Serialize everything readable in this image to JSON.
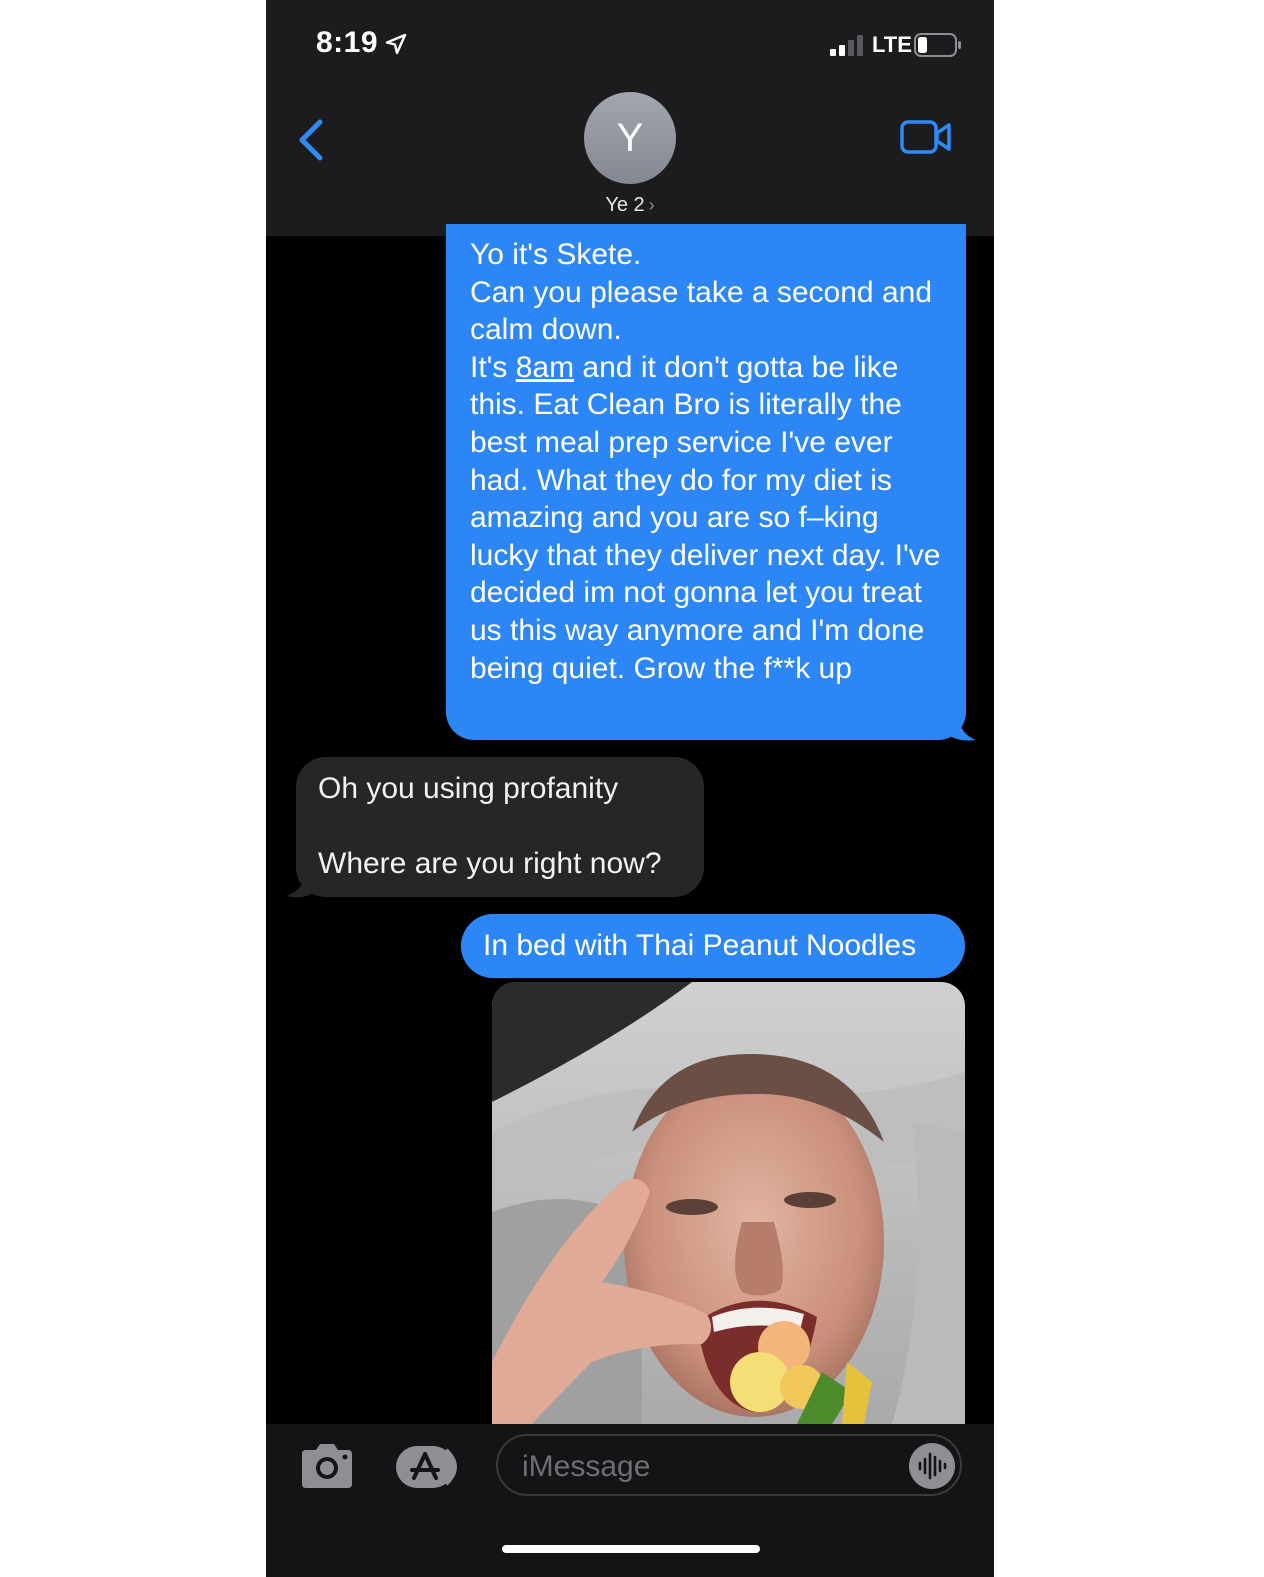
{
  "status_bar": {
    "time": "8:19",
    "network": "LTE"
  },
  "header": {
    "avatar_initial": "Y",
    "contact_name": "Ye 2",
    "chevron": "›"
  },
  "messages": [
    {
      "direction": "outgoing",
      "lines": [
        "Yo it's Skete.",
        "Can you please take a second and calm down.",
        "It's ",
        "8am",
        " and it don't gotta be like this. Eat Clean Bro is literally the best meal prep service I've ever had. What they do for my diet is amazing and you are so f–king lucky that they deliver next day. I've decided im not gonna let you treat us this way anymore and I'm done being quiet. Grow the f**k up"
      ]
    },
    {
      "direction": "incoming",
      "text": "Oh you using profanity\n\nWhere are you right now?"
    },
    {
      "direction": "outgoing",
      "text": "In bed with Thai Peanut Noodles"
    },
    {
      "direction": "outgoing",
      "type": "photo"
    }
  ],
  "input": {
    "placeholder": "iMessage"
  },
  "icons": [
    "location-arrow-icon",
    "signal-icon",
    "battery-icon",
    "back-chevron-icon",
    "video-camera-icon",
    "camera-icon",
    "app-store-icon",
    "audio-waveform-icon"
  ],
  "colors": {
    "outgoing_bubble": "#2d86f6",
    "incoming_bubble": "#262628",
    "accent": "#2f8af5"
  }
}
